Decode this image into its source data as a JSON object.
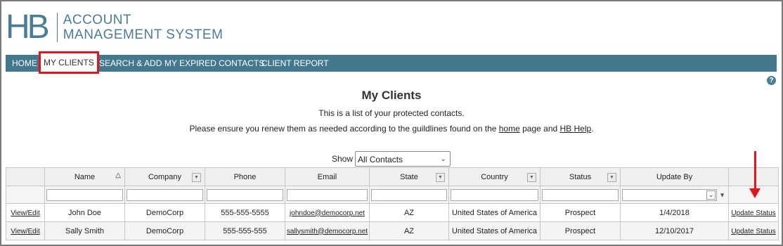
{
  "logo": {
    "mark": "HB",
    "line1": "ACCOUNT",
    "line2": "MANAGEMENT SYSTEM"
  },
  "nav": [
    {
      "label": "HOME"
    },
    {
      "label": "MY CLIENTS",
      "active": true
    },
    {
      "label": "SEARCH & ADD"
    },
    {
      "label": "MY EXPIRED CONTACTS"
    },
    {
      "label": "CLIENT REPORT"
    }
  ],
  "help_icon": "?",
  "page": {
    "title": "My Clients",
    "line1": "This is a list of your protected contacts.",
    "line2_pre": "Please ensure you renew them as needed according to the guildlines found on the ",
    "line2_link1": "home",
    "line2_mid": " page and ",
    "line2_link2": "HB Help",
    "line2_post": "."
  },
  "show": {
    "label": "Show",
    "value": "All Contacts"
  },
  "table": {
    "columns": [
      "",
      "Name",
      "Company",
      "Phone",
      "Email",
      "State",
      "Country",
      "Status",
      "Update By",
      ""
    ],
    "rows": [
      {
        "action": "View/Edit",
        "name": "John Doe",
        "company": "DemoCorp",
        "phone": "555-555-5555",
        "email": "johndoe@democorp.net",
        "state": "AZ",
        "country": "United States of America",
        "status": "Prospect",
        "update_by": "1/4/2018",
        "update_link": "Update Status"
      },
      {
        "action": "View/Edit",
        "name": "Sally Smith",
        "company": "DemoCorp",
        "phone": "555-555-555",
        "email": "sallysmith@democorp.net",
        "state": "AZ",
        "country": "United States of America",
        "status": "Prospect",
        "update_by": "12/10/2017",
        "update_link": "Update Status"
      }
    ]
  },
  "colors": {
    "nav_bg": "#44788f",
    "brand": "#4b7d96",
    "highlight": "#e3141b"
  }
}
